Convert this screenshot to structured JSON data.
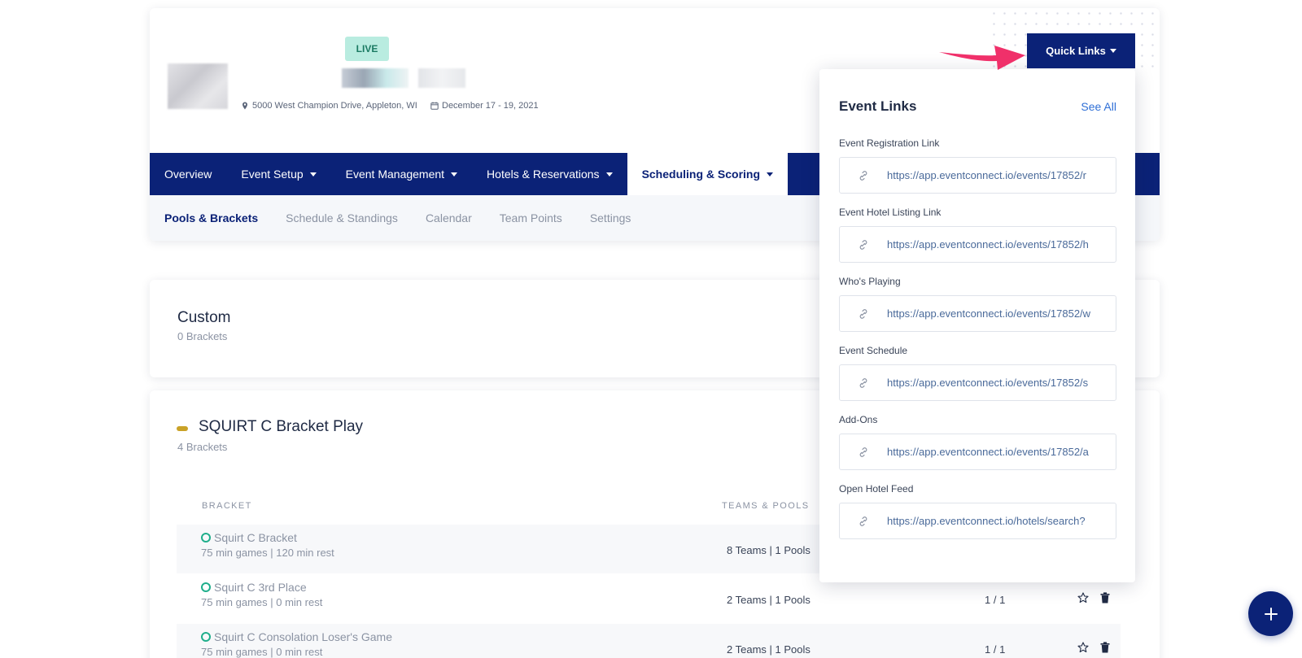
{
  "event": {
    "status_badge": "LIVE",
    "location": "5000 West Champion Drive, Appleton, WI",
    "dates": "December 17 - 19, 2021"
  },
  "quick_links_button": "Quick Links",
  "main_nav": [
    {
      "label": "Overview",
      "dropdown": false,
      "active": false
    },
    {
      "label": "Event Setup",
      "dropdown": true,
      "active": false
    },
    {
      "label": "Event Management",
      "dropdown": true,
      "active": false
    },
    {
      "label": "Hotels & Reservations",
      "dropdown": true,
      "active": false
    },
    {
      "label": "Scheduling & Scoring",
      "dropdown": true,
      "active": true
    }
  ],
  "sub_nav": [
    {
      "label": "Pools & Brackets",
      "active": true
    },
    {
      "label": "Schedule & Standings",
      "active": false
    },
    {
      "label": "Calendar",
      "active": false
    },
    {
      "label": "Team Points",
      "active": false
    },
    {
      "label": "Settings",
      "active": false
    }
  ],
  "custom_group": {
    "title": "Custom",
    "subtitle": "0 Brackets"
  },
  "squirt_group": {
    "title": "SQUIRT C Bracket Play",
    "subtitle": "4 Brackets",
    "columns": {
      "bracket": "BRACKET",
      "teams_pools": "TEAMS & POOLS"
    },
    "rows": [
      {
        "name": "Squirt C Bracket",
        "detail": "75 min games | 120 min rest",
        "teams": "8 Teams | 1 Pools",
        "ratio": ""
      },
      {
        "name": "Squirt C 3rd Place",
        "detail": "75 min games | 0 min rest",
        "teams": "2 Teams | 1 Pools",
        "ratio": "1 / 1"
      },
      {
        "name": "Squirt C Consolation Loser's Game",
        "detail": "75 min games | 0 min rest",
        "teams": "2 Teams | 1 Pools",
        "ratio": "1 / 1"
      }
    ]
  },
  "event_links": {
    "title": "Event Links",
    "see_all": "See All",
    "links": [
      {
        "label": "Event Registration Link",
        "url": "https://app.eventconnect.io/events/17852/r"
      },
      {
        "label": "Event Hotel Listing Link",
        "url": "https://app.eventconnect.io/events/17852/h"
      },
      {
        "label": "Who's Playing",
        "url": "https://app.eventconnect.io/events/17852/w"
      },
      {
        "label": "Event Schedule",
        "url": "https://app.eventconnect.io/events/17852/s"
      },
      {
        "label": "Add-Ons",
        "url": "https://app.eventconnect.io/events/17852/a"
      },
      {
        "label": "Open Hotel Feed",
        "url": "https://app.eventconnect.io/hotels/search?"
      }
    ]
  },
  "colors": {
    "brand": "#0b2277",
    "accent_pink": "#f0306a",
    "live_bg": "#b9ece0",
    "group_pill": "#c9a227",
    "status_ring": "#1fae8b"
  },
  "icons": [
    "map-marker-icon",
    "calendar-icon",
    "chevron-down-icon",
    "link-icon",
    "circle-status-icon",
    "star-icon",
    "trash-icon",
    "plus-icon"
  ]
}
